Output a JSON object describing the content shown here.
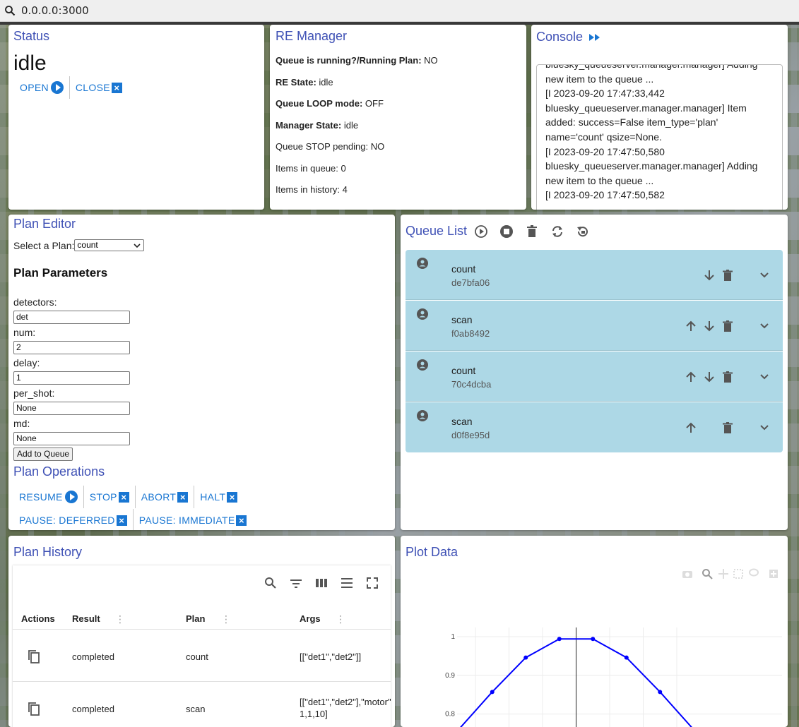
{
  "browser": {
    "url": "0.0.0.0:3000"
  },
  "status": {
    "title": "Status",
    "state": "idle",
    "open_label": "OPEN",
    "close_label": "CLOSE"
  },
  "re_manager": {
    "title": "RE Manager",
    "lines": [
      {
        "label": "Queue is running?/Running Plan:",
        "value": "NO",
        "bold": true
      },
      {
        "label": "RE State:",
        "value": "idle",
        "bold": true
      },
      {
        "label": "Queue LOOP mode:",
        "value": "OFF",
        "bold": true
      },
      {
        "label": "Manager State:",
        "value": "idle",
        "bold": true
      },
      {
        "label": "Queue STOP pending:",
        "value": "NO",
        "bold": false
      },
      {
        "label": "Items in queue:",
        "value": "0",
        "bold": false
      },
      {
        "label": "Items in history:",
        "value": "4",
        "bold": false
      }
    ]
  },
  "console": {
    "title": "Console",
    "lines": [
      "bluesky_queueserver.manager.manager] Adding",
      "new item to the queue ...",
      "[I 2023-09-20 17:47:33,442",
      "bluesky_queueserver.manager.manager] Item",
      "added: success=False item_type='plan'",
      "name='count' qsize=None.",
      "[I 2023-09-20 17:47:50,580",
      "bluesky_queueserver.manager.manager] Adding",
      "new item to the queue ...",
      "[I 2023-09-20 17:47:50,582"
    ]
  },
  "plan_editor": {
    "title": "Plan Editor",
    "select_label": "Select a Plan:",
    "selected_plan": "count",
    "params_heading": "Plan Parameters",
    "fields": [
      {
        "label": "detectors:",
        "value": "det"
      },
      {
        "label": "num:",
        "value": "2"
      },
      {
        "label": "delay:",
        "value": "1"
      },
      {
        "label": "per_shot:",
        "value": "None"
      },
      {
        "label": "md:",
        "value": "None"
      }
    ],
    "add_button": "Add to Queue"
  },
  "plan_operations": {
    "title": "Plan Operations",
    "resume": "RESUME",
    "stop": "STOP",
    "abort": "ABORT",
    "halt": "HALT",
    "pause_deferred": "PAUSE: DEFERRED",
    "pause_immediate": "PAUSE: IMMEDIATE"
  },
  "queue_list": {
    "title": "Queue List",
    "items": [
      {
        "name": "count",
        "uid": "de7bfa06"
      },
      {
        "name": "scan",
        "uid": "f0ab8492"
      },
      {
        "name": "count",
        "uid": "70c4dcba"
      },
      {
        "name": "scan",
        "uid": "d0f8e95d"
      }
    ]
  },
  "plan_history": {
    "title": "Plan History",
    "columns": {
      "actions": "Actions",
      "result": "Result",
      "plan": "Plan",
      "args": "Args"
    },
    "rows": [
      {
        "result": "completed",
        "plan": "count",
        "args": "[[\"det1\",\"det2\"]]",
        "args2": ""
      },
      {
        "result": "completed",
        "plan": "scan",
        "args": "[[\"det1\",\"det2\"],\"motor\"",
        "args2": "1,1,10]"
      }
    ]
  },
  "plot": {
    "title": "Plot Data"
  },
  "chart_data": {
    "type": "line",
    "title": "",
    "xlabel": "",
    "ylabel": "",
    "yticks": [
      "1",
      "0.9",
      "0.8"
    ],
    "x": [
      -2.5,
      -1.5,
      -0.5,
      0.5,
      1.5,
      2.5
    ],
    "y": [
      0.857,
      0.946,
      0.994,
      0.994,
      0.946,
      0.857
    ],
    "line_color": "#0000ff",
    "grid": true
  }
}
